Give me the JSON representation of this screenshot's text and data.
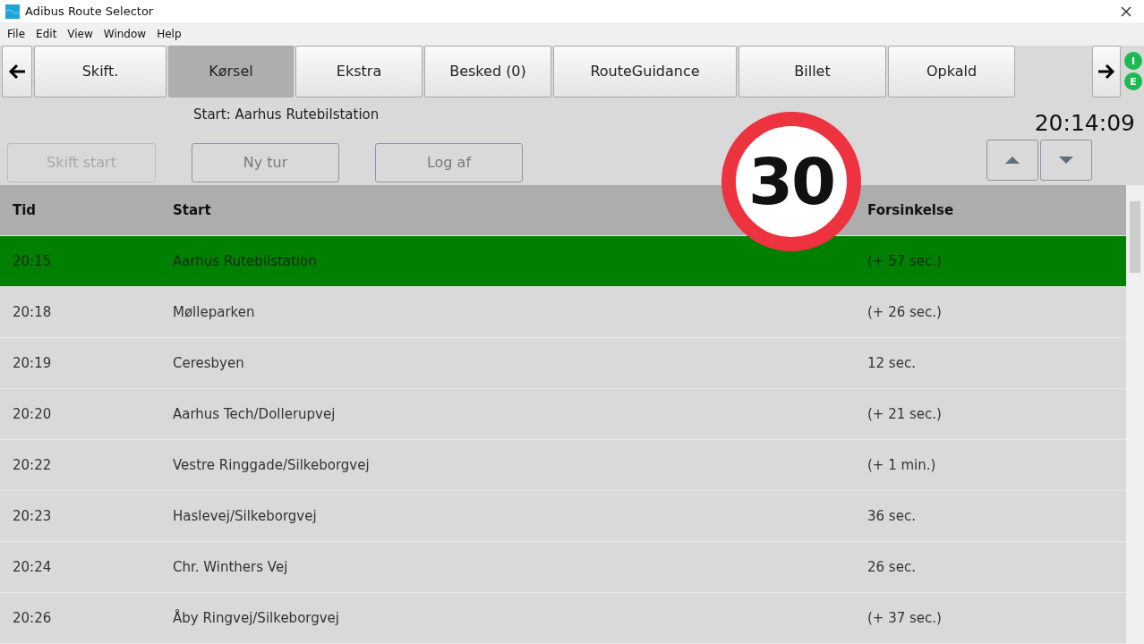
{
  "window": {
    "title": "Adibus Route Selector"
  },
  "menu": [
    "File",
    "Edit",
    "View",
    "Window",
    "Help"
  ],
  "tabs": [
    {
      "label": "Skift.",
      "selected": false
    },
    {
      "label": "Kørsel",
      "selected": true
    },
    {
      "label": "Ekstra",
      "selected": false
    },
    {
      "label": "Besked (0)",
      "selected": false
    },
    {
      "label": "RouteGuidance",
      "selected": false
    },
    {
      "label": "Billet",
      "selected": false
    },
    {
      "label": "Opkald",
      "selected": false
    }
  ],
  "indicators": [
    {
      "label": "I",
      "color": "#1db954"
    },
    {
      "label": "E",
      "color": "#1db954"
    }
  ],
  "start_label": "Start: Aarhus Rutebilstation",
  "clock": "20:14:09",
  "actions": [
    {
      "label": "Skift start",
      "disabled": true
    },
    {
      "label": "Ny tur",
      "disabled": false
    },
    {
      "label": "Log af",
      "disabled": false
    }
  ],
  "speed_sign": "30",
  "table": {
    "columns": [
      "Tid",
      "Start",
      "Forsinkelse"
    ],
    "rows": [
      {
        "cells": [
          "20:15",
          "Aarhus Rutebilstation",
          "(+ 57 sec.)"
        ],
        "selected": true
      },
      {
        "cells": [
          "20:18",
          "Mølleparken",
          "(+ 26 sec.)"
        ],
        "selected": false
      },
      {
        "cells": [
          "20:19",
          "Ceresbyen",
          "12 sec."
        ],
        "selected": false
      },
      {
        "cells": [
          "20:20",
          "Aarhus Tech/Dollerupvej",
          "(+ 21 sec.)"
        ],
        "selected": false
      },
      {
        "cells": [
          "20:22",
          "Vestre Ringgade/Silkeborgvej",
          "(+ 1 min.)"
        ],
        "selected": false
      },
      {
        "cells": [
          "20:23",
          "Haslevej/Silkeborgvej",
          "36 sec."
        ],
        "selected": false
      },
      {
        "cells": [
          "20:24",
          "Chr. Winthers Vej",
          "26 sec."
        ],
        "selected": false
      },
      {
        "cells": [
          "20:26",
          "Åby Ringvej/Silkeborgvej",
          "(+ 37 sec.)"
        ],
        "selected": false
      }
    ]
  }
}
